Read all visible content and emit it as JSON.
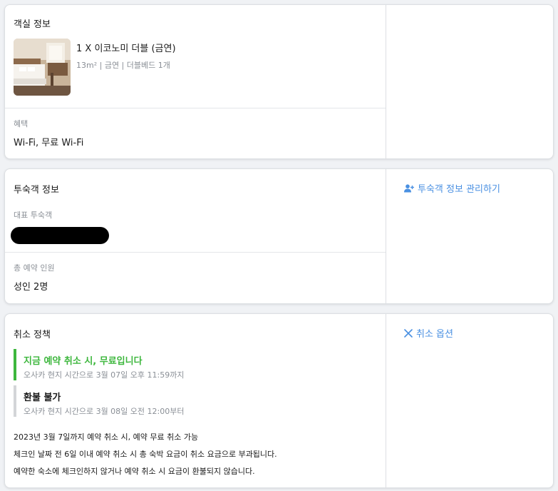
{
  "room": {
    "section_title": "객실 정보",
    "room_name": "1 X 이코노미 더블 (금연)",
    "room_spec": "13m² | 금연 | 더블베드 1개",
    "benefits_label": "혜택",
    "benefits_value": "Wi-Fi, 무료 Wi-Fi"
  },
  "guest": {
    "section_title": "투숙객 정보",
    "primary_guest_label": "대표 투숙객",
    "total_guests_label": "총 예약 인원",
    "total_guests_value": "성인 2명",
    "manage_link": "투숙객 정보 관리하기"
  },
  "cancellation": {
    "section_title": "취소 정책",
    "cancel_option_link": "취소 옵션",
    "policies": [
      {
        "title": "지금 예약 취소 시, 무료입니다",
        "detail": "오사카 현지 시간으로 3월 07일 오후 11:59까지",
        "color": "#3db73d"
      },
      {
        "title": "환불 불가",
        "detail": "오사카 현지 시간으로 3월 08일 오전 12:00부터",
        "color": "#d3d5d8"
      }
    ],
    "notes": [
      "2023년 3월 7일까지 예약 취소 시, 예약 무료 취소 가능",
      "체크인 날짜 전 6일 이내 예약 취소 시 총 숙박 요금이 취소 요금으로 부과됩니다.",
      "예약한 숙소에 체크인하지 않거나 예약 취소 시 요금이 환불되지 않습니다."
    ]
  },
  "colors": {
    "accent_link": "#4a90e2",
    "free_cancel": "#3db73d",
    "muted_text": "#8a8f96"
  },
  "icons": {
    "room_thumbnail": "hotel-room-photo",
    "manage_guest": "user-plus-icon",
    "cancel_option": "close-icon"
  }
}
